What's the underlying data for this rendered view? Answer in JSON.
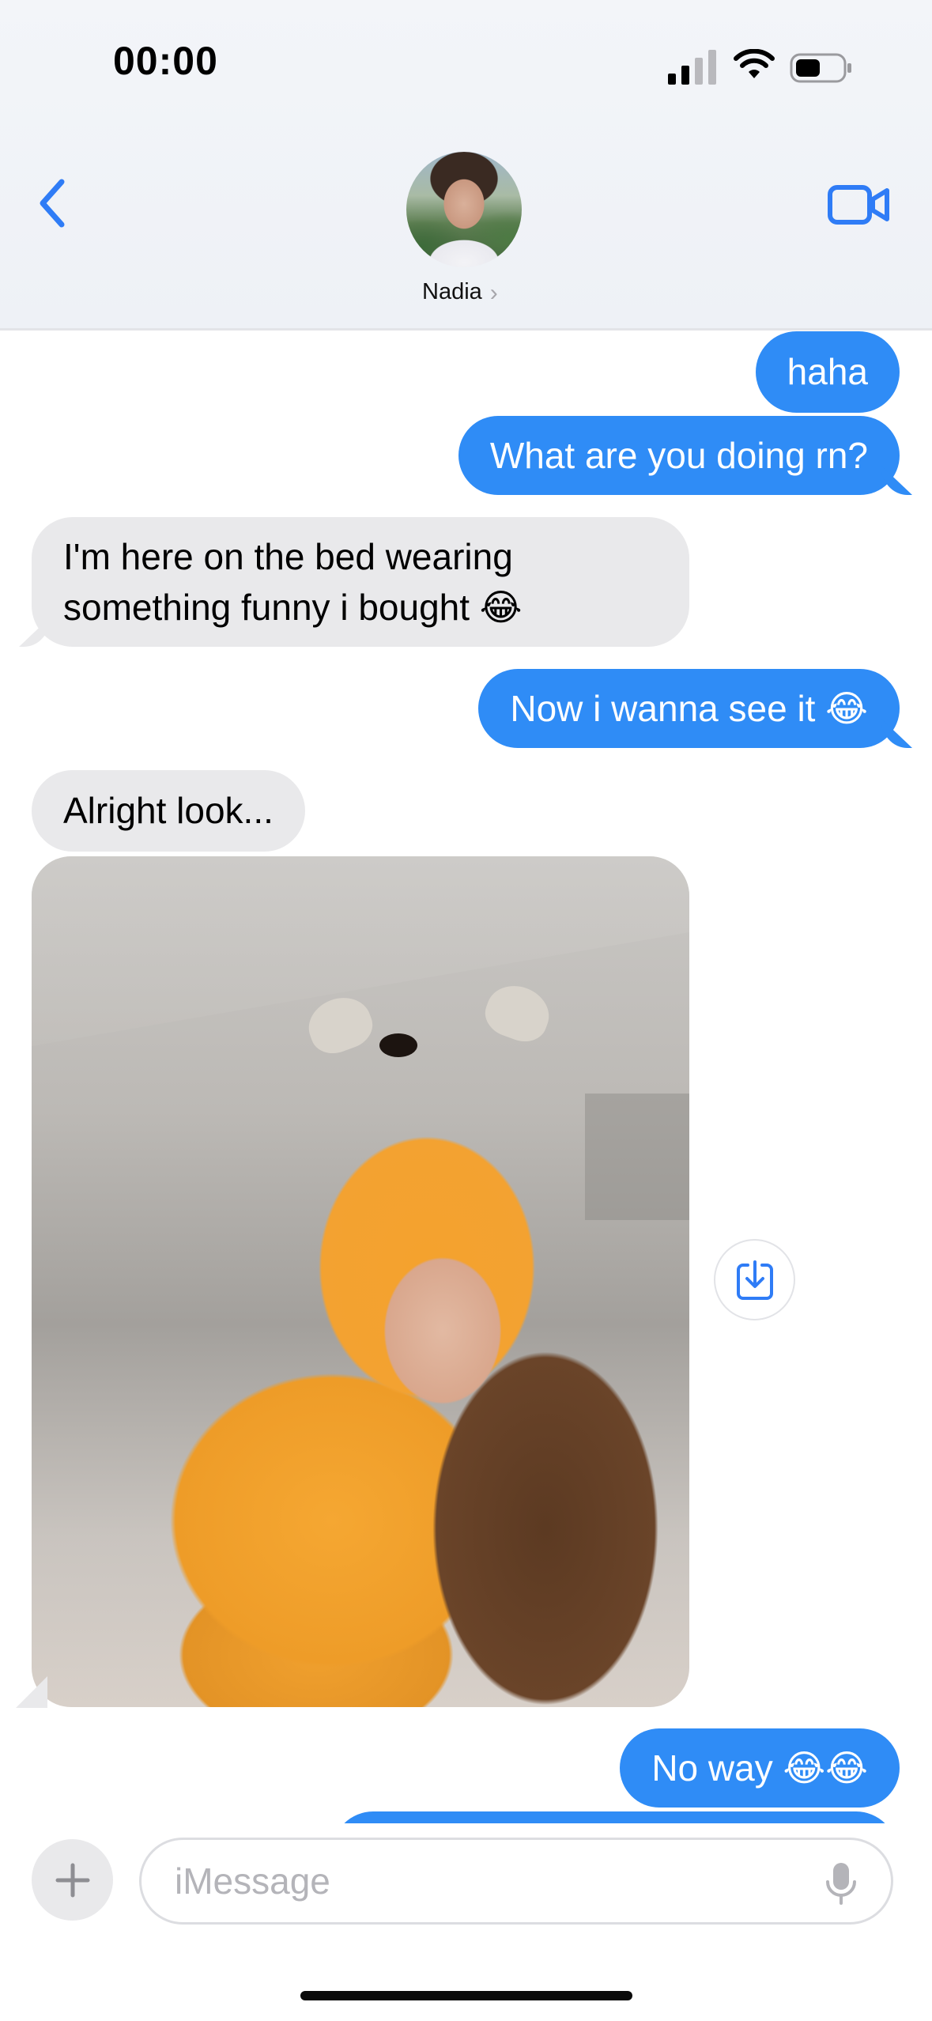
{
  "status_bar": {
    "time": "00:00",
    "signal_icon": "cellular-signal-icon",
    "wifi_icon": "wifi-icon",
    "battery_icon": "battery-icon"
  },
  "header": {
    "contact_name": "Nadia",
    "chevron": "›",
    "back_icon": "chevron-left-icon",
    "video_icon": "video-camera-icon"
  },
  "messages": [
    {
      "from": "me",
      "text": "haha"
    },
    {
      "from": "me",
      "text": "What are you doing rn?"
    },
    {
      "from": "them",
      "line1": "I'm here on the bed wearing",
      "line2": "something funny i bought 😂"
    },
    {
      "from": "me",
      "text": "Now i wanna see it 😂"
    },
    {
      "from": "them",
      "text": "Alright look..."
    },
    {
      "from": "them",
      "type": "photo"
    },
    {
      "from": "me",
      "text": "No way 😂😂"
    }
  ],
  "photo": {
    "save_icon": "save-download-icon"
  },
  "input": {
    "placeholder": "iMessage",
    "value": "",
    "plus_icon": "plus-icon",
    "mic_icon": "microphone-icon"
  },
  "colors": {
    "sent_bubble": "#2f8cf6",
    "received_bubble": "#e9e9eb",
    "accent": "#2f7cf6"
  }
}
